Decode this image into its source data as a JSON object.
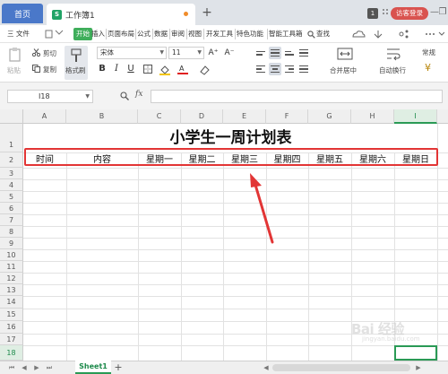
{
  "titlebar": {
    "home_tab": "首页",
    "doc_tab": "工作簿1",
    "doc_icon": "S",
    "new_tab": "+",
    "badge": "1",
    "visitor_login": "访客登录",
    "window_controls": [
      "—",
      "❐",
      "✕"
    ]
  },
  "menubar": {
    "file_menu": "三 文件",
    "items": [
      "开始",
      "插入",
      "页面布局",
      "公式",
      "数据",
      "审阅",
      "视图",
      "开发工具",
      "特色功能",
      "智能工具箱"
    ],
    "search": "查找"
  },
  "ribbon": {
    "paste": "粘贴",
    "cut": "剪切",
    "copy": "复制",
    "format_painter": "格式刷",
    "font_name": "宋体",
    "font_size": "11",
    "merge_center": "合并居中",
    "wrap_text": "自动换行",
    "number_format": "常规",
    "bold": "B",
    "italic": "I",
    "underline": "U",
    "font_grow": "A⁺",
    "font_shrink": "A⁻"
  },
  "formulabar": {
    "cell_ref": "I18",
    "fx": "fx"
  },
  "grid": {
    "columns": [
      "A",
      "B",
      "C",
      "D",
      "E",
      "F",
      "G",
      "H",
      "I"
    ],
    "selected_column": "I",
    "rows": [
      "1",
      "2",
      "3",
      "4",
      "5",
      "6",
      "7",
      "8",
      "9",
      "10",
      "11",
      "12",
      "13",
      "14",
      "15",
      "16",
      "17",
      "18"
    ],
    "selected_row": "18",
    "title": "小学生一周计划表",
    "header_row": [
      "时间",
      "内容",
      "星期一",
      "星期二",
      "星期三",
      "星期四",
      "星期五",
      "星期六",
      "星期日"
    ]
  },
  "sheets": {
    "active": "Sheet1",
    "add": "+"
  },
  "watermark": {
    "brand": "Bai 经验",
    "sub": "jingyan.baidu.com"
  },
  "colors": {
    "accent_green": "#2a9a55",
    "annotation_red": "#e23535",
    "home_tab_blue": "#4a78c9",
    "visitor_red": "#d9534f"
  }
}
